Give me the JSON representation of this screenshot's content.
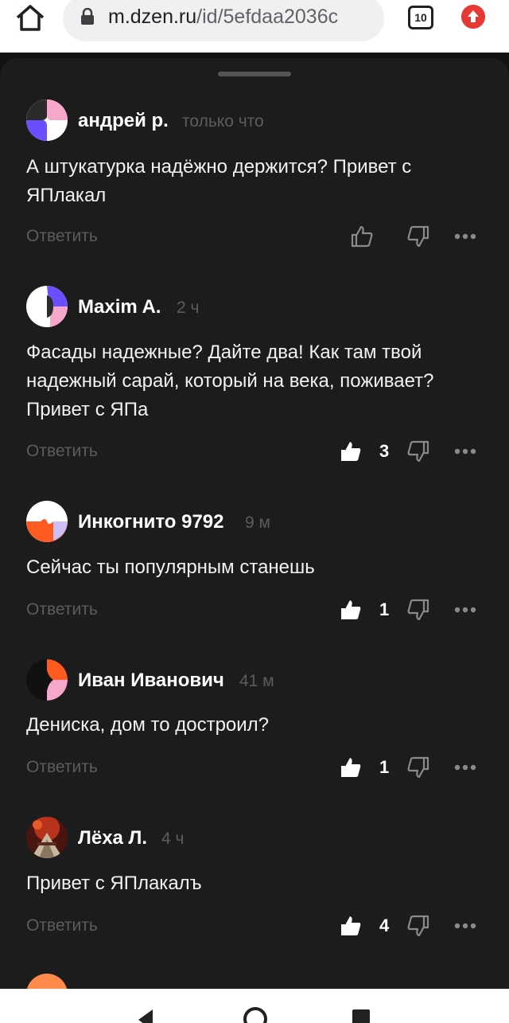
{
  "browser": {
    "url_host": "m.dzen.ru",
    "url_path": "/id/5efdaa2036c",
    "tab_count": "10"
  },
  "comments": [
    {
      "author": "андрей р.",
      "time": "только что",
      "text": "А штукатурка надёжно держится? Привет с ЯПлакал",
      "reply": "Ответить",
      "likes": ""
    },
    {
      "author": "Maxim A.",
      "time": "2 ч",
      "text": "Фасады надежные? Дайте два! Как там твой надежный сарай, который на века, поживает? Привет с ЯПа",
      "reply": "Ответить",
      "likes": "3"
    },
    {
      "author": "Инкогнито 9792",
      "time": "9 м",
      "text": "Сейчас ты популярным станешь",
      "reply": "Ответить",
      "likes": "1"
    },
    {
      "author": "Иван Иванович",
      "time": "41 м",
      "text": "Дениска, дом то достроил?",
      "reply": "Ответить",
      "likes": "1"
    },
    {
      "author": "Лёха Л.",
      "time": "4 ч",
      "text": "Привет с ЯПлакалъ",
      "reply": "Ответить",
      "likes": "4"
    }
  ],
  "colors": {
    "sheet_background": "#1c1c1c",
    "muted_text": "#5c5c5c",
    "update_badge": "#e53935"
  },
  "icons": [
    "home-icon",
    "lock-icon",
    "tab-switcher-icon",
    "update-icon",
    "like-icon",
    "dislike-icon",
    "more-icon",
    "back-icon",
    "home-nav-icon",
    "recents-icon"
  ]
}
